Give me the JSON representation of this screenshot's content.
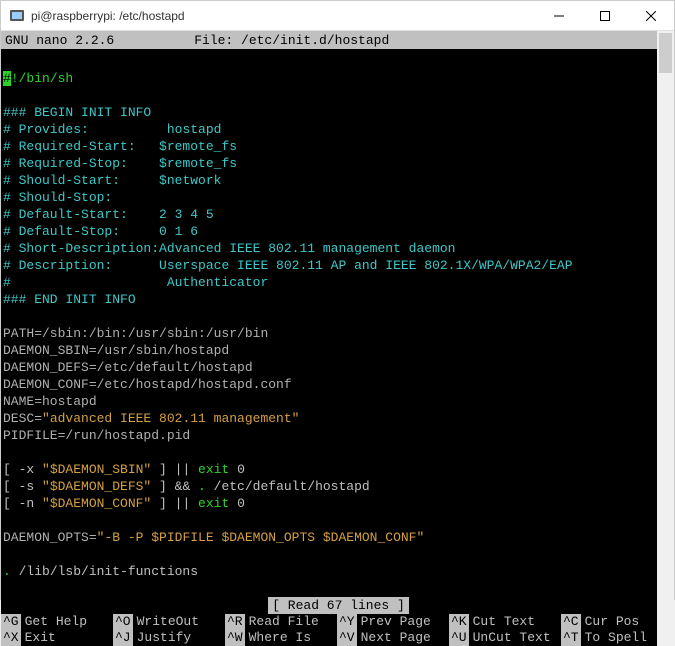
{
  "window": {
    "title": "pi@raspberrypi: /etc/hostapd"
  },
  "nano": {
    "version": "GNU nano 2.2.6",
    "file_label": "File: /etc/init.d/hostapd",
    "status": "[ Read 67 lines ]"
  },
  "content": {
    "shebang_prefix": "#",
    "shebang": "!/bin/sh",
    "init_begin": "### BEGIN INIT INFO",
    "init_end": "### END INIT INFO",
    "provides_k": "# Provides:",
    "provides_v": "hostapd",
    "req_start_k": "# Required-Start:",
    "req_start_v": "$remote_fs",
    "req_stop_k": "# Required-Stop:",
    "req_stop_v": "$remote_fs",
    "should_start_k": "# Should-Start:",
    "should_start_v": "$network",
    "should_stop_k": "# Should-Stop:",
    "def_start_k": "# Default-Start:",
    "def_start_v": "2 3 4 5",
    "def_stop_k": "# Default-Stop:",
    "def_stop_v": "0 1 6",
    "short_desc_k": "# Short-Description:",
    "short_desc_v": "Advanced IEEE 802.11 management daemon",
    "desc_k": "# Description:",
    "desc_v1": "Userspace IEEE 802.11 AP and IEEE 802.1X/WPA/WPA2/EAP",
    "desc_v2": "Authenticator",
    "path": "PATH=/sbin:/bin:/usr/sbin:/usr/bin",
    "daemon_sbin": "DAEMON_SBIN=/usr/sbin/hostapd",
    "daemon_defs": "DAEMON_DEFS=/etc/default/hostapd",
    "daemon_conf": "DAEMON_CONF=/etc/hostapd/hostapd.conf",
    "name": "NAME=hostapd",
    "desc_var_k": "DESC=",
    "desc_var_v": "\"advanced IEEE 802.11 management\"",
    "pidfile": "PIDFILE=/run/hostapd.pid",
    "test1_a": "[ -x ",
    "test1_b": "\"$DAEMON_SBIN\"",
    "test1_c": " ] || ",
    "test1_d": "exit",
    "test1_e": " 0",
    "test2_a": "[ -s ",
    "test2_b": "\"$DAEMON_DEFS\"",
    "test2_c": " ] && ",
    "test2_d": ". ",
    "test2_e": "/etc/default/hostapd",
    "test3_a": "[ -n ",
    "test3_b": "\"$DAEMON_CONF\"",
    "test3_c": " ] || ",
    "test3_d": "exit",
    "test3_e": " 0",
    "opts_k": "DAEMON_OPTS=",
    "opts_v": "\"-B -P $PIDFILE $DAEMON_OPTS $DAEMON_CONF\"",
    "initfuncs_a": ". ",
    "initfuncs_b": "/lib/lsb/init-functions"
  },
  "shortcuts": {
    "row1": [
      {
        "key": "^G",
        "label": "Get Help"
      },
      {
        "key": "^O",
        "label": "WriteOut"
      },
      {
        "key": "^R",
        "label": "Read File"
      },
      {
        "key": "^Y",
        "label": "Prev Page"
      },
      {
        "key": "^K",
        "label": "Cut Text"
      },
      {
        "key": "^C",
        "label": "Cur Pos"
      }
    ],
    "row2": [
      {
        "key": "^X",
        "label": "Exit"
      },
      {
        "key": "^J",
        "label": "Justify"
      },
      {
        "key": "^W",
        "label": "Where Is"
      },
      {
        "key": "^V",
        "label": "Next Page"
      },
      {
        "key": "^U",
        "label": "UnCut Text"
      },
      {
        "key": "^T",
        "label": "To Spell"
      }
    ]
  }
}
